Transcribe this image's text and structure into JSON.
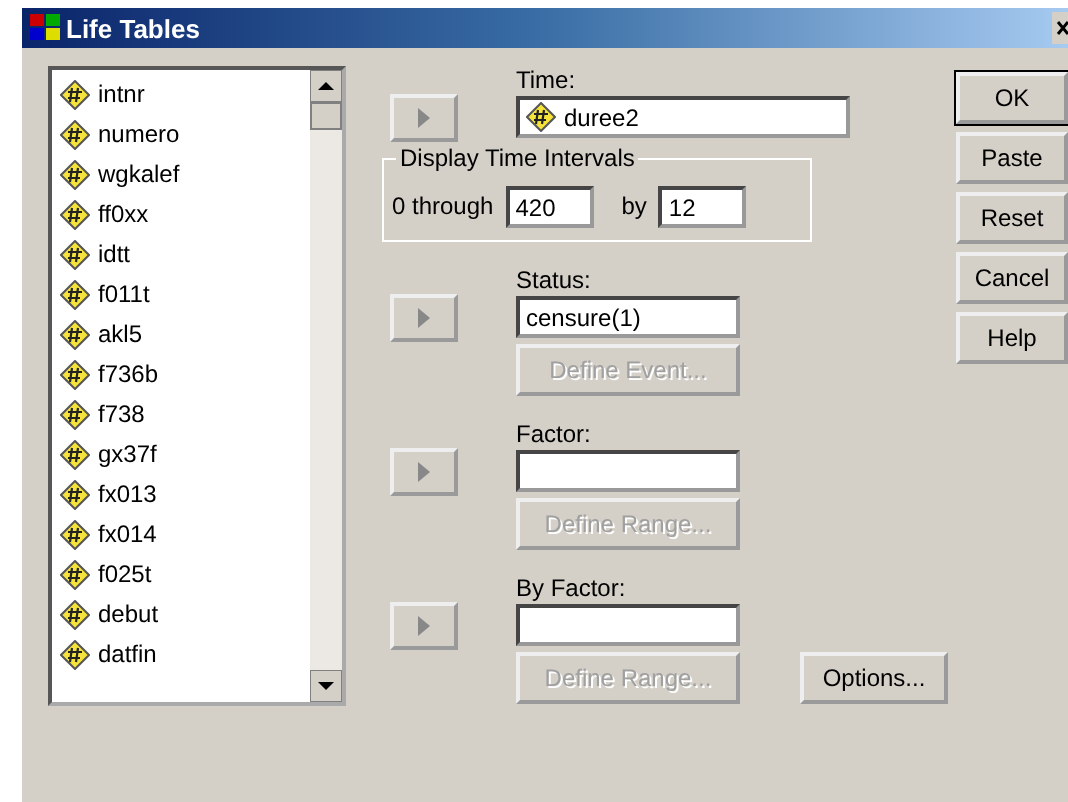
{
  "window": {
    "title": "Life Tables"
  },
  "variables": [
    "intnr",
    "numero",
    "wgkalef",
    "ff0xx",
    "idtt",
    "f011t",
    "akl5",
    "f736b",
    "f738",
    "gx37f",
    "fx013",
    "fx014",
    "f025t",
    "debut",
    "datfin"
  ],
  "time": {
    "label": "Time:",
    "value": "duree2"
  },
  "intervals": {
    "legend": "Display Time Intervals",
    "through_label": "0 through",
    "through": "420",
    "by_label": "by",
    "by": "12"
  },
  "sections": [
    {
      "label": "Status:",
      "value": "censure(1)",
      "button": "Define Event...",
      "disabled": true
    },
    {
      "label": "Factor:",
      "button": "Define Range...",
      "disabled": true
    },
    {
      "label": "By Factor:",
      "button": "Define Range...",
      "disabled": true
    }
  ],
  "options_button": "Options...",
  "buttons": [
    {
      "label": "OK",
      "default": true
    },
    {
      "label": "Paste",
      "default": false
    },
    {
      "label": "Reset",
      "default": false
    },
    {
      "label": "Cancel",
      "default": false
    },
    {
      "label": "Help",
      "default": false
    }
  ]
}
